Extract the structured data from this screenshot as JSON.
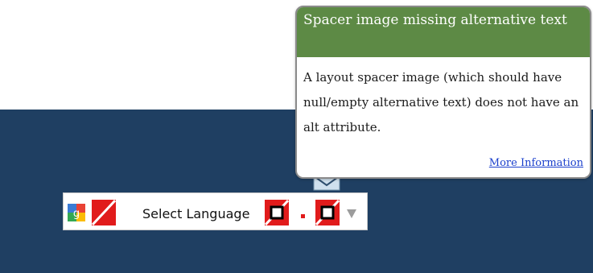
{
  "translate_widget": {
    "label": "Select Language",
    "logo_icon": "google-g-icon",
    "error_icon": "broken-image-icon",
    "dropdown_icon": "dropdown-arrow-icon"
  },
  "tooltip": {
    "title": "Spacer image missing alternative text",
    "body": "A layout spacer image (which should have null/empty alternative text) does not have an alt attribute.",
    "link_label": "More Information"
  },
  "colors": {
    "navy_band": "#1f3f62",
    "tooltip_header": "#5d8a45",
    "error_red": "#e11b1b",
    "link_blue": "#1a3fcc"
  }
}
